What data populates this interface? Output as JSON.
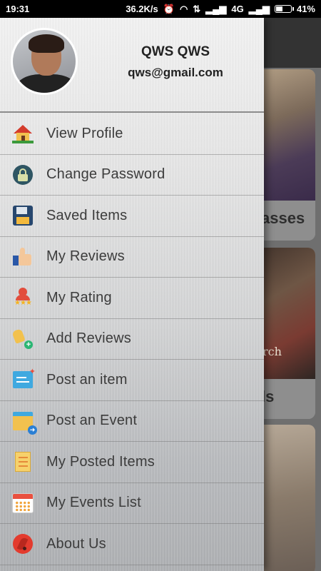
{
  "status_bar": {
    "time": "19:31",
    "network_speed": "36.2K/s",
    "network_type": "4G",
    "battery_percent": "41%",
    "battery_level": 0.41,
    "icons": [
      "alarm-icon",
      "wifi-icon",
      "data-arrows-icon",
      "signal-icon",
      "signal-icon",
      "battery-icon"
    ]
  },
  "drawer": {
    "user": {
      "name": "QWS QWS",
      "email": "qws@gmail.com"
    },
    "items": [
      {
        "label": "View Profile",
        "icon": "house-icon"
      },
      {
        "label": "Change Password",
        "icon": "lock-icon"
      },
      {
        "label": "Saved Items",
        "icon": "floppy-disk-icon"
      },
      {
        "label": "My Reviews",
        "icon": "thumbs-up-icon"
      },
      {
        "label": "My Rating",
        "icon": "rating-stars-icon"
      },
      {
        "label": "Add Reviews",
        "icon": "add-review-icon"
      },
      {
        "label": "Post an item",
        "icon": "post-item-icon"
      },
      {
        "label": "Post an Event",
        "icon": "post-event-icon"
      },
      {
        "label": "My Posted Items",
        "icon": "notes-icon"
      },
      {
        "label": "My Events List",
        "icon": "calendar-icon"
      },
      {
        "label": "About Us",
        "icon": "about-icon"
      }
    ]
  },
  "background": {
    "card_captions": [
      "asses",
      "ls",
      ""
    ],
    "card2_overlay_text": "rch"
  },
  "colors": {
    "status_bar": "#000000",
    "label_text": "#3c3c3c",
    "header_text": "#222222"
  }
}
